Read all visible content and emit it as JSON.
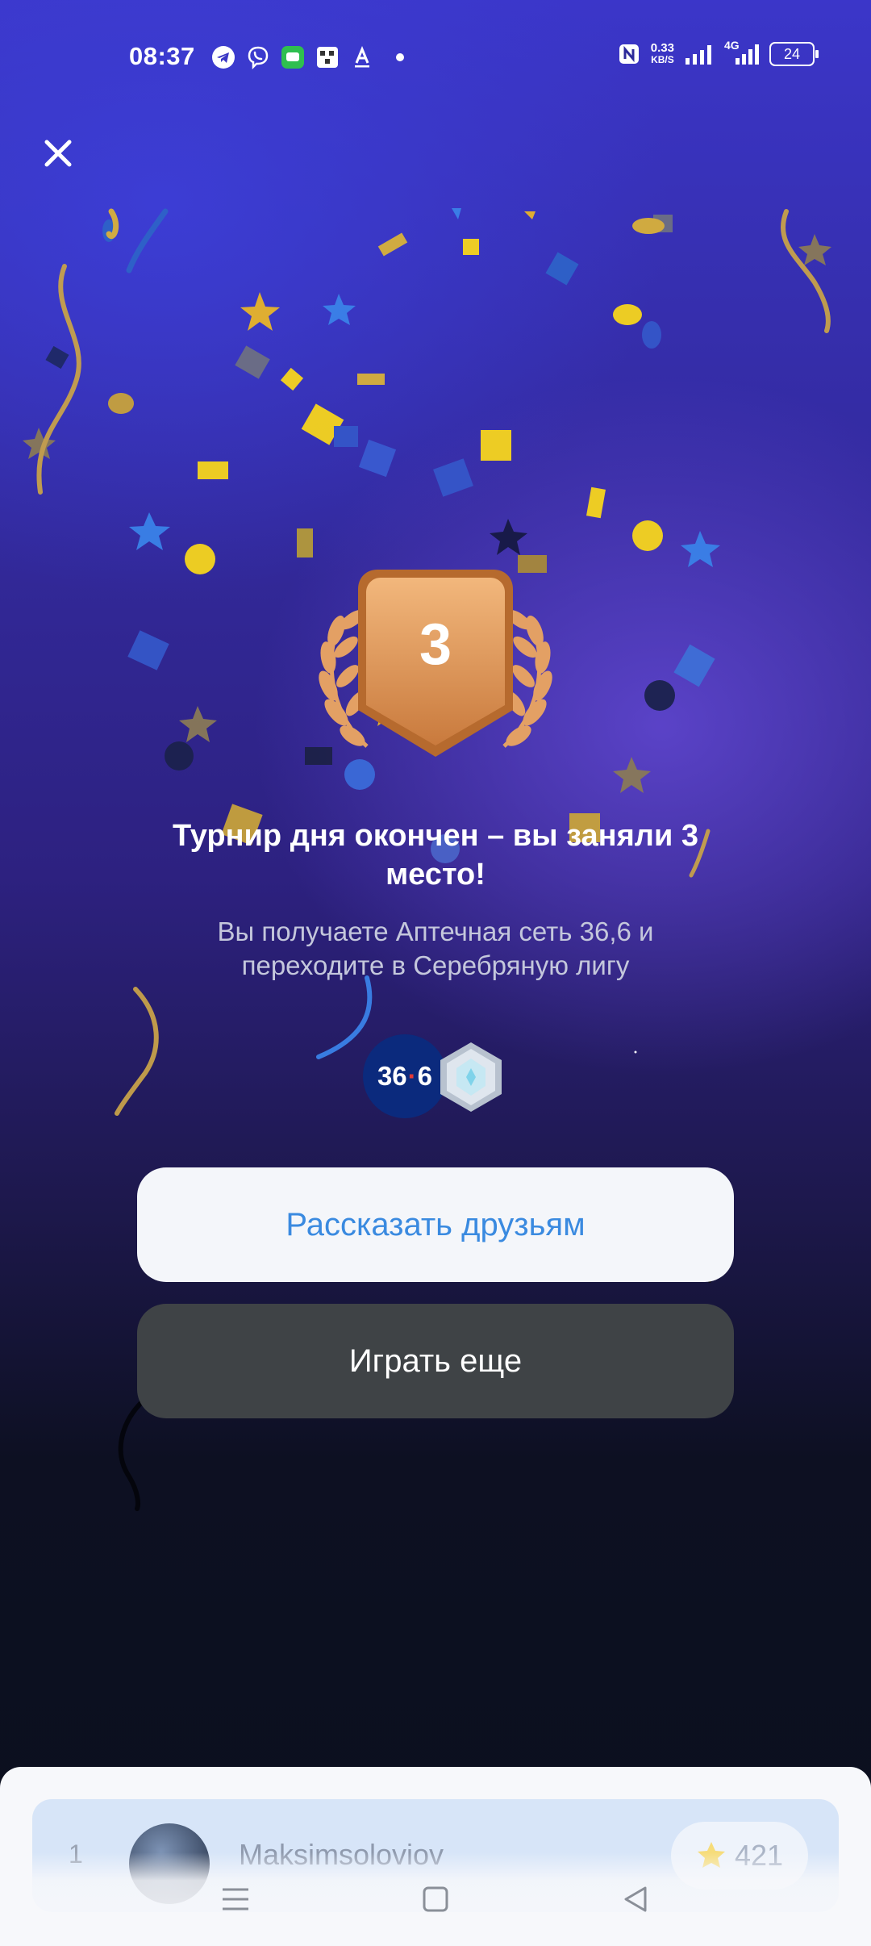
{
  "status_bar": {
    "time": "08:37",
    "net_speed_value": "0.33",
    "net_speed_unit": "KB/S",
    "network_type": "4G",
    "battery": "24"
  },
  "result": {
    "place": "3",
    "title": "Турнир дня окончен – вы заняли 3 место!",
    "subtitle": "Вы получаете Аптечная сеть 36,6 и переходите в Серебряную лигу"
  },
  "rewards": {
    "pharmacy_logo_left": "36",
    "pharmacy_logo_right": "6"
  },
  "buttons": {
    "share": "Рассказать друзьям",
    "play_again": "Играть еще"
  },
  "leaderboard": {
    "rank": "1",
    "name": "Maksimsoloviov",
    "score": "421"
  },
  "colors": {
    "accent": "#3a8ae0",
    "gold": "#f7d51d",
    "bronze": "#d9945a"
  }
}
